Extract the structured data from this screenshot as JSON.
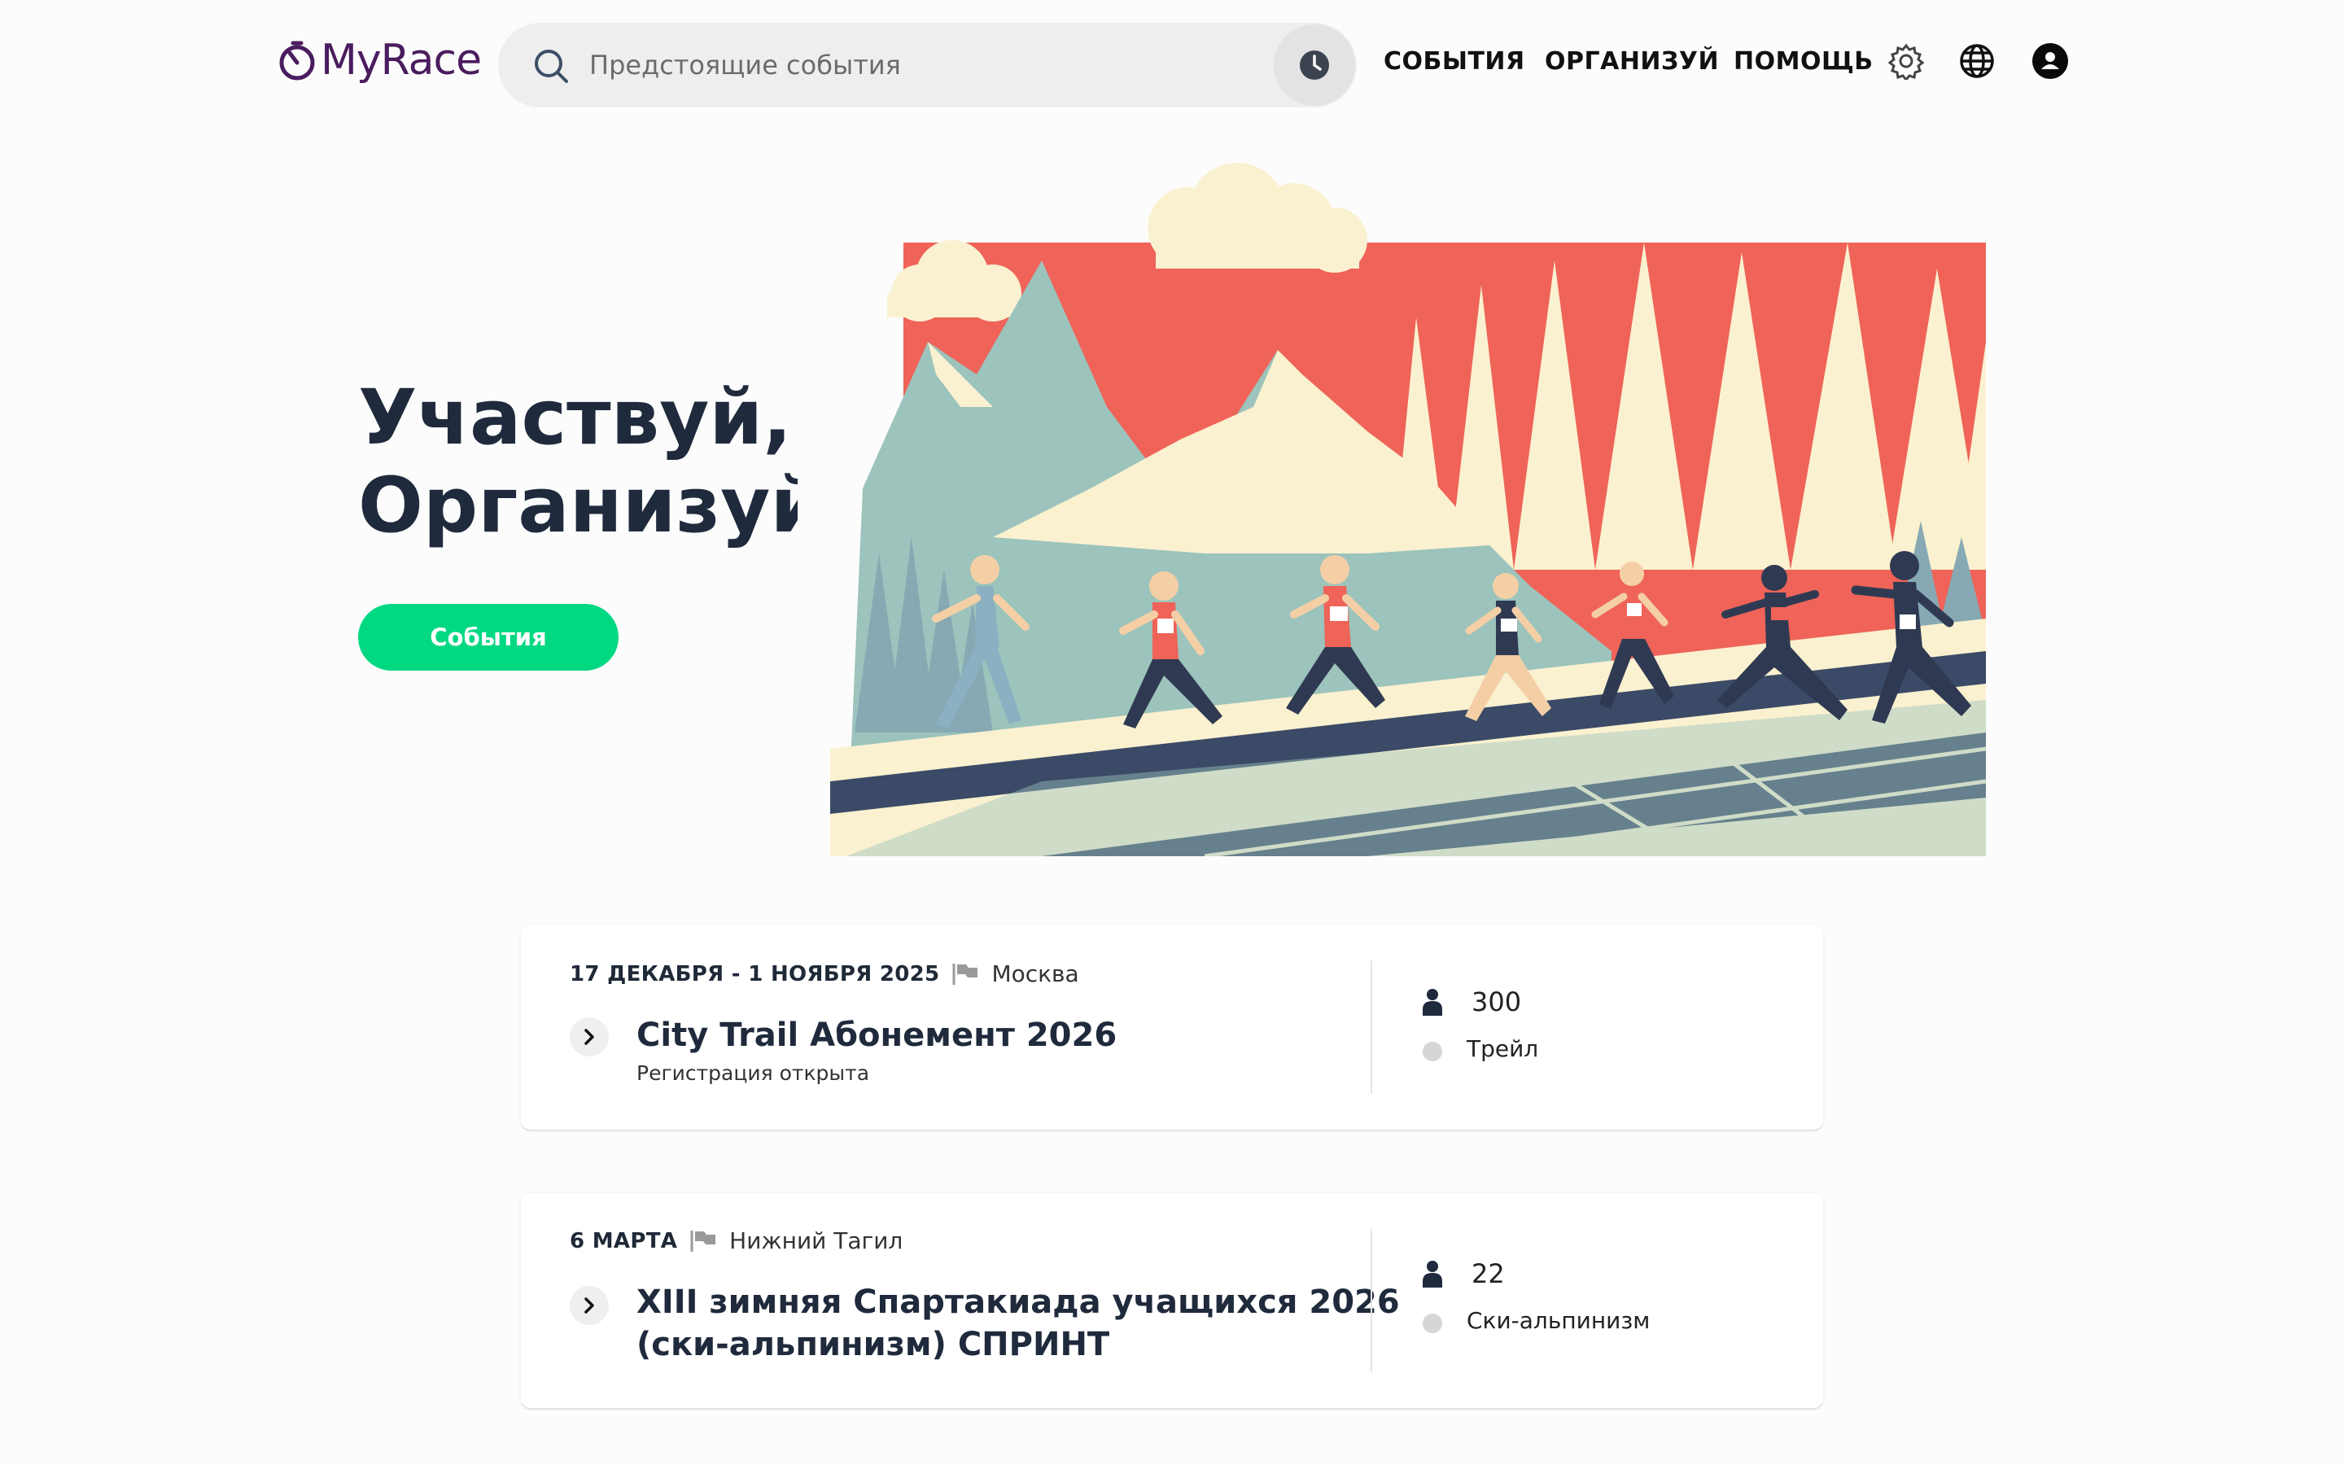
{
  "header": {
    "logo_text": "MyRace",
    "search_placeholder": "Предстоящие события",
    "nav": {
      "events": "СОБЫТИЯ",
      "organize": "ОРГАНИЗУЙ",
      "help": "ПОМОЩЬ"
    },
    "icons": [
      "search-icon",
      "history-icon",
      "gear-icon",
      "globe-icon",
      "account-icon"
    ]
  },
  "hero": {
    "title_line1": "Участвуй,",
    "title_line2": "Организуй",
    "cta_label": "События"
  },
  "events": [
    {
      "date": "17 ДЕКАБРЯ - 1 НОЯБРЯ 2025",
      "city": "Москва",
      "title_lines": [
        "City Trail Абонемент 2026"
      ],
      "status": "Регистрация открыта",
      "participants": "300",
      "type": "Трейл"
    },
    {
      "date": "6 МАРТА",
      "city": "Нижний Тагил",
      "title_lines": [
        "XIII зимняя Спартакиада учащихся 2026",
        "(ски-альпинизм) СПРИНТ"
      ],
      "status": "",
      "participants": "22",
      "type": "Ски-альпинизм"
    }
  ],
  "colors": {
    "brand": "#4a1c5e",
    "accent": "#00d882",
    "heading": "#1f2a3c",
    "search_bg": "#eeeeee"
  }
}
